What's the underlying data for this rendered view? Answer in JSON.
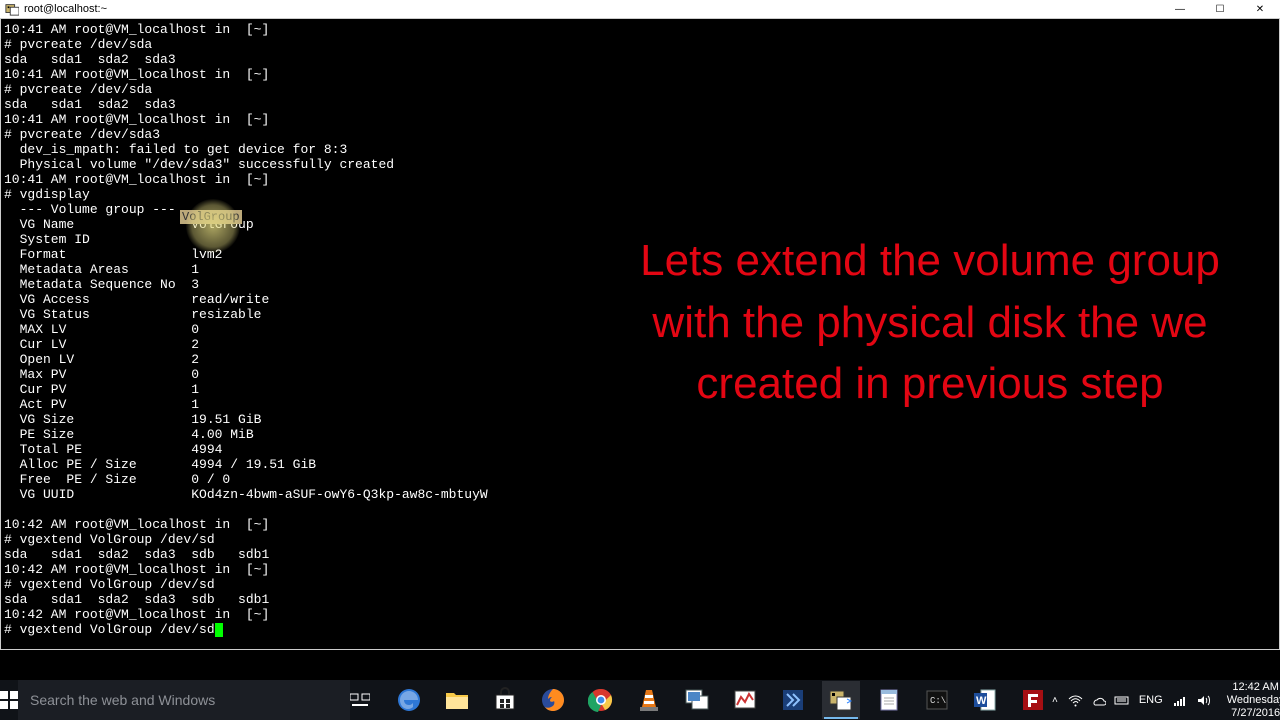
{
  "window": {
    "title": "root@localhost:~",
    "controls": {
      "min": "—",
      "max": "☐",
      "close": "✕"
    }
  },
  "terminal": {
    "lines": [
      "10:41 AM root@VM_localhost in  [~]",
      "# pvcreate /dev/sda",
      "sda   sda1  sda2  sda3",
      "10:41 AM root@VM_localhost in  [~]",
      "# pvcreate /dev/sda",
      "sda   sda1  sda2  sda3",
      "10:41 AM root@VM_localhost in  [~]",
      "# pvcreate /dev/sda3",
      "  dev_is_mpath: failed to get device for 8:3",
      "  Physical volume \"/dev/sda3\" successfully created",
      "10:41 AM root@VM_localhost in  [~]",
      "# vgdisplay",
      "  --- Volume group ---",
      "  VG Name               VolGroup",
      "  System ID",
      "  Format                lvm2",
      "  Metadata Areas        1",
      "  Metadata Sequence No  3",
      "  VG Access             read/write",
      "  VG Status             resizable",
      "  MAX LV                0",
      "  Cur LV                2",
      "  Open LV               2",
      "  Max PV                0",
      "  Cur PV                1",
      "  Act PV                1",
      "  VG Size               19.51 GiB",
      "  PE Size               4.00 MiB",
      "  Total PE              4994",
      "  Alloc PE / Size       4994 / 19.51 GiB",
      "  Free  PE / Size       0 / 0",
      "  VG UUID               KOd4zn-4bwm-aSUF-owY6-Q3kp-aw8c-mbtuyW",
      "",
      "10:42 AM root@VM_localhost in  [~]",
      "# vgextend VolGroup /dev/sd",
      "sda   sda1  sda2  sda3  sdb   sdb1",
      "10:42 AM root@VM_localhost in  [~]",
      "# vgextend VolGroup /dev/sd",
      "sda   sda1  sda2  sda3  sdb   sdb1",
      "10:42 AM root@VM_localhost in  [~]"
    ],
    "current_line": "# vgextend VolGroup /dev/sd",
    "highlighted_text": "VolGroup"
  },
  "overlay_text": "Lets extend the volume group with the physical disk the we created in previous step",
  "taskbar": {
    "search_placeholder": "Search the web and Windows",
    "apps": [
      "edge",
      "explorer",
      "store",
      "firefox",
      "chrome",
      "vlc",
      "vmware",
      "perfmon",
      "vbox",
      "putty",
      "notepad",
      "cmd",
      "word",
      "filezilla"
    ],
    "tray": {
      "lang": "ENG",
      "time": "12:42 AM",
      "day": "Wednesday",
      "date": "7/27/2016"
    }
  }
}
